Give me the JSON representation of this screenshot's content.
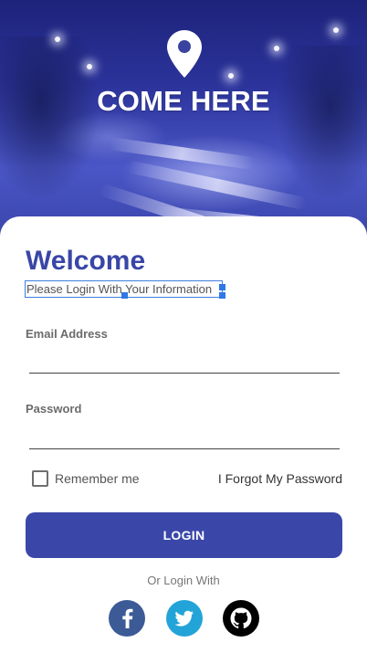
{
  "hero": {
    "brand_title": "COME HERE",
    "icon": "location-pin-icon"
  },
  "login": {
    "welcome_title": "Welcome",
    "subtitle": "Please Login With Your Information",
    "email_label": "Email Address",
    "email_value": "",
    "password_label": "Password",
    "password_value": "",
    "remember_label": "Remember me",
    "remember_checked": false,
    "forgot_label": "I Forgot My Password",
    "login_button_label": "LOGIN",
    "or_login_with": "Or Login With"
  },
  "social": [
    {
      "name": "facebook",
      "icon": "facebook-icon",
      "color": "#3b5a96"
    },
    {
      "name": "twitter",
      "icon": "twitter-icon",
      "color": "#23a4d8"
    },
    {
      "name": "github",
      "icon": "github-icon",
      "color": "#000000"
    }
  ],
  "colors": {
    "primary": "#3a47a8",
    "selection_outline": "#3f7de0"
  }
}
